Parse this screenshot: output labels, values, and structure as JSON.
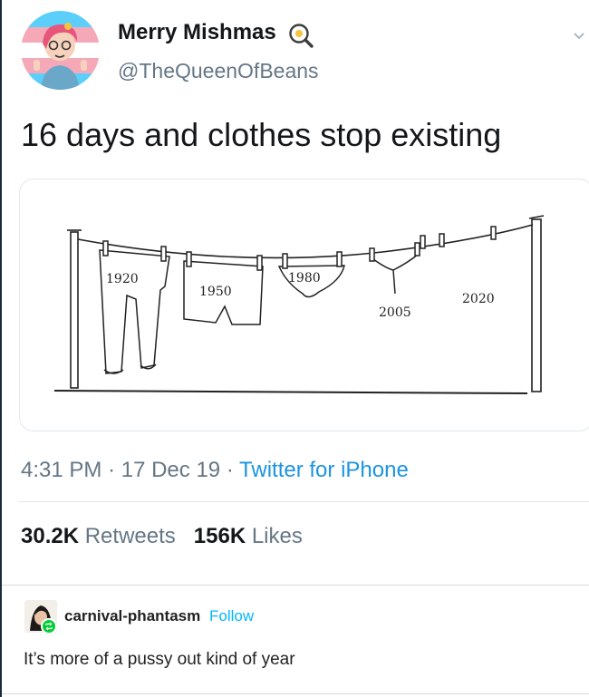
{
  "tweet": {
    "display_name": "Merry Mishmas",
    "name_icon": "magnifier-egg-icon",
    "handle": "@TheQueenOfBeans",
    "text": "16 days and clothes stop existing",
    "time": "4:31 PM",
    "date": "17 Dec 19",
    "separator": "·",
    "source": "Twitter for iPhone",
    "retweets_count": "30.2K",
    "retweets_label": "Retweets",
    "likes_count": "156K",
    "likes_label": "Likes",
    "menu_icon": "chevron-down-icon"
  },
  "image": {
    "labels": [
      "1920",
      "1950",
      "1980",
      "2005",
      "2020"
    ]
  },
  "tumblr": {
    "username": "carnival-phantasm",
    "follow_label": "Follow",
    "comment": "It’s more of a pussy out kind of year",
    "badge_icon": "reblog-icon"
  },
  "colors": {
    "link": "#1b95e0",
    "muted": "#657786",
    "follow": "#00b8ff",
    "reblog_badge": "#00cf35"
  }
}
